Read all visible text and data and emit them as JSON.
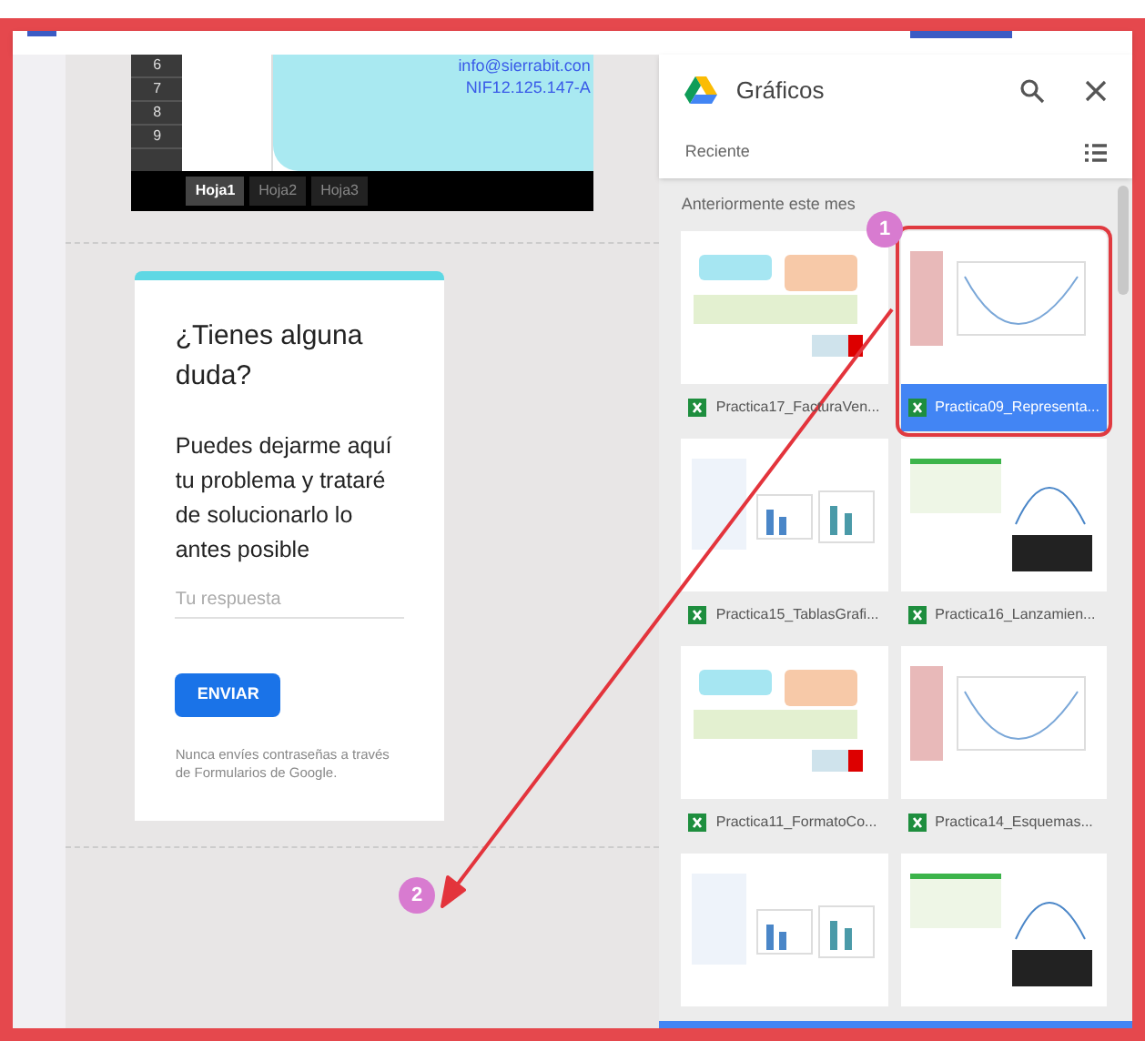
{
  "spreadsheet": {
    "row_numbers": [
      "6",
      "7",
      "8",
      "9"
    ],
    "contact_lines": [
      "info@sierrabit.con",
      "NIF12.125.147-A"
    ],
    "sheet_tabs": [
      {
        "label": "Hoja1",
        "selected": true
      },
      {
        "label": "Hoja2",
        "selected": false
      },
      {
        "label": "Hoja3",
        "selected": false
      }
    ]
  },
  "form": {
    "title": "¿Tienes alguna duda?",
    "description": "Puedes dejarme aquí tu problema y trataré de solucionarlo lo antes posible",
    "answer": {
      "placeholder": "Tu respuesta"
    },
    "submit": "ENVIAR",
    "footer": "Nunca envíes contraseñas a través de Formularios de Google."
  },
  "picker": {
    "title": "Gráficos",
    "section": "Reciente",
    "group": "Anteriormente este mes",
    "files": [
      {
        "name": "Practica17_FacturaVen...",
        "selected": false
      },
      {
        "name": "Practica09_Representa...",
        "selected": true
      },
      {
        "name": "Practica15_TablasGrafi...",
        "selected": false
      },
      {
        "name": "Practica16_Lanzamien...",
        "selected": false
      },
      {
        "name": "Practica11_FormatoCo...",
        "selected": false
      },
      {
        "name": "Practica14_Esquemas...",
        "selected": false
      },
      {
        "selected": false
      },
      {
        "selected": false
      }
    ]
  },
  "annotations": [
    {
      "label": "1"
    },
    {
      "label": "2"
    }
  ]
}
